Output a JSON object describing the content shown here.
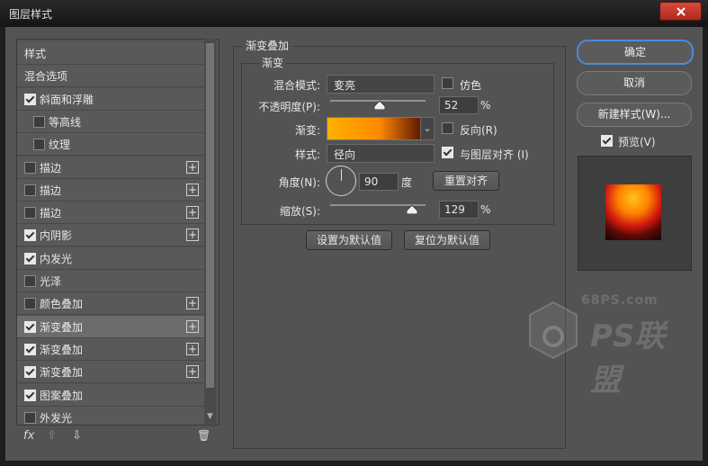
{
  "window": {
    "title": "图层样式"
  },
  "style_list": {
    "items": [
      {
        "label": "样式",
        "checkbox": false,
        "checked": false,
        "indent": 0,
        "plus": false,
        "selected": false
      },
      {
        "label": "混合选项",
        "checkbox": false,
        "checked": false,
        "indent": 0,
        "plus": false,
        "selected": false
      },
      {
        "label": "斜面和浮雕",
        "checkbox": true,
        "checked": true,
        "indent": 0,
        "plus": false,
        "selected": false
      },
      {
        "label": "等高线",
        "checkbox": true,
        "checked": false,
        "indent": 1,
        "plus": false,
        "selected": false
      },
      {
        "label": "纹理",
        "checkbox": true,
        "checked": false,
        "indent": 1,
        "plus": false,
        "selected": false
      },
      {
        "label": "描边",
        "checkbox": true,
        "checked": false,
        "indent": 0,
        "plus": true,
        "selected": false
      },
      {
        "label": "描边",
        "checkbox": true,
        "checked": false,
        "indent": 0,
        "plus": true,
        "selected": false
      },
      {
        "label": "描边",
        "checkbox": true,
        "checked": false,
        "indent": 0,
        "plus": true,
        "selected": false
      },
      {
        "label": "内阴影",
        "checkbox": true,
        "checked": true,
        "indent": 0,
        "plus": true,
        "selected": false
      },
      {
        "label": "内发光",
        "checkbox": true,
        "checked": true,
        "indent": 0,
        "plus": false,
        "selected": false
      },
      {
        "label": "光泽",
        "checkbox": true,
        "checked": false,
        "indent": 0,
        "plus": false,
        "selected": false
      },
      {
        "label": "颜色叠加",
        "checkbox": true,
        "checked": false,
        "indent": 0,
        "plus": true,
        "selected": false
      },
      {
        "label": "渐变叠加",
        "checkbox": true,
        "checked": true,
        "indent": 0,
        "plus": true,
        "selected": true
      },
      {
        "label": "渐变叠加",
        "checkbox": true,
        "checked": true,
        "indent": 0,
        "plus": true,
        "selected": false
      },
      {
        "label": "渐变叠加",
        "checkbox": true,
        "checked": true,
        "indent": 0,
        "plus": true,
        "selected": false
      },
      {
        "label": "图案叠加",
        "checkbox": true,
        "checked": true,
        "indent": 0,
        "plus": false,
        "selected": false
      },
      {
        "label": "外发光",
        "checkbox": true,
        "checked": false,
        "indent": 0,
        "plus": false,
        "selected": false
      }
    ],
    "tools": {
      "fx": "fx",
      "up": "⇧",
      "down": "⇩",
      "trash": "🗑"
    }
  },
  "gradient_overlay": {
    "section_title": "渐变叠加",
    "group_title": "渐变",
    "blend_mode_label": "混合模式:",
    "blend_mode_value": "变亮",
    "dither_label": "仿色",
    "dither_checked": false,
    "opacity_label": "不透明度(P):",
    "opacity_value": "52",
    "opacity_unit": "%",
    "opacity_fraction": 0.52,
    "gradient_label": "渐变:",
    "gradient_colors": [
      "#ffb000",
      "#ff8a00",
      "#5a1800"
    ],
    "reverse_label": "反向(R)",
    "reverse_checked": false,
    "style_label": "样式:",
    "style_value": "径向",
    "align_label": "与图层对齐 (I)",
    "align_checked": true,
    "angle_label": "角度(N):",
    "angle_value": "90",
    "angle_unit": "度",
    "reset_align_label": "重置对齐",
    "scale_label": "缩放(S):",
    "scale_value": "129",
    "scale_unit": "%",
    "scale_fraction": 0.86,
    "set_default_label": "设置为默认值",
    "reset_default_label": "复位为默认值"
  },
  "side_buttons": {
    "ok": "确定",
    "cancel": "取消",
    "new_style": "新建样式(W)...",
    "preview_label": "预览(V)",
    "preview_checked": true
  },
  "watermark": {
    "site": "68PS.com",
    "logo_text": "PS联盟"
  },
  "colors": {
    "primary_border": "#4a8cd8",
    "close_red": "#c8392b"
  }
}
